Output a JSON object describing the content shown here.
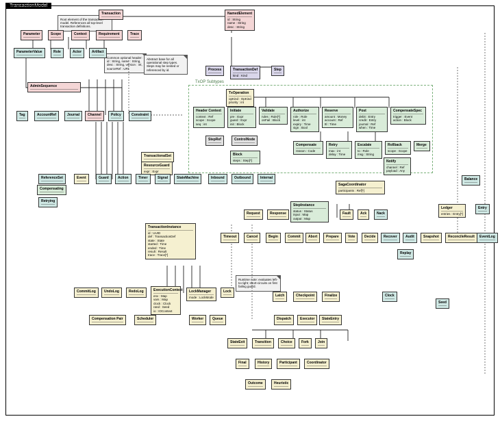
{
  "title": "TransactionModel",
  "package": {
    "label": "TxOP Subtypes"
  },
  "notes": [
    {
      "id": "n1",
      "text": "Root element of the transaction model. References all top-level transaction definitions."
    },
    {
      "id": "n2",
      "text": "Common optional header: id : String, name : String, desc : String, version : int, sourceRef : URI"
    },
    {
      "id": "n3",
      "text": "Abstract base for all operational step types. Steps may be nested or referenced by id."
    },
    {
      "id": "n4",
      "text": "Runtime note: evaluates left-to-right; short-circuits on first failing guard."
    }
  ],
  "nodes": {
    "root": {
      "name": "Transaction"
    },
    "base": {
      "name": "NamedElement",
      "attrs": [
        "id : String",
        "name : String",
        "desc : String"
      ]
    },
    "p_a": {
      "name": "Parameter"
    },
    "p_b": {
      "name": "Scope"
    },
    "p_c": {
      "name": "Context"
    },
    "p_d": {
      "name": "Requirement"
    },
    "p_e": {
      "name": "Trace"
    },
    "t_a": {
      "name": "ParameterValue"
    },
    "t_b": {
      "name": "Role"
    },
    "t_c": {
      "name": "Actor"
    },
    "t_d": {
      "name": "Artifact"
    },
    "t_e": {
      "name": "Tag"
    },
    "t_f": {
      "name": "AccountRef"
    },
    "t_g": {
      "name": "Journal"
    },
    "t_h": {
      "name": "Channel"
    },
    "t_i": {
      "name": "Policy"
    },
    "t_j": {
      "name": "Constraint"
    },
    "row_a": {
      "name": "AdminSequence"
    },
    "row_b": {
      "name": "ReferenceSet"
    },
    "li_a": {
      "name": "Process"
    },
    "li_b": {
      "name": "TransactionDef",
      "attrs": [
        "kind : Kind"
      ]
    },
    "li_c": {
      "name": "Step"
    },
    "mid_a": {
      "name": "StepRef"
    },
    "mid_b": {
      "name": "ControlNode"
    },
    "op_root": {
      "name": "TxOperation",
      "attrs": [
        "opKind : OpKind",
        "priority : int"
      ]
    },
    "op0": {
      "name": "Header Context",
      "attrs": [
        "context : Ref",
        "scope : Scope",
        "seq : int"
      ]
    },
    "op1": {
      "name": "Initiate",
      "attrs": [
        "pre : Expr",
        "guard : Expr",
        "init : Block"
      ]
    },
    "op2": {
      "name": "Validate",
      "attrs": [
        "rules : Rule[*]",
        "onFail : Block"
      ]
    },
    "op3": {
      "name": "Authorize",
      "attrs": [
        "role : Role",
        "level : int",
        "expiry : Time",
        "sign : Bool"
      ]
    },
    "op4": {
      "name": "Reserve",
      "attrs": [
        "amount : Money",
        "account : Ref",
        "ttl : Time"
      ]
    },
    "op5": {
      "name": "Post",
      "attrs": [
        "debit : Entry",
        "credit : Entry",
        "journal : Ref",
        "when : Time"
      ]
    },
    "op6": {
      "name": "CompensateSpec",
      "attrs": [
        "trigger : Event",
        "action : Block"
      ]
    },
    "opChild": {
      "name": "Block",
      "attrs": [
        "steps : Step[*]"
      ]
    },
    "op_a": {
      "name": "Compensate",
      "attrs": [
        "reason : Code"
      ]
    },
    "op_b": {
      "name": "Retry",
      "attrs": [
        "max : int",
        "delay : Time"
      ]
    },
    "op_c": {
      "name": "Escalate",
      "attrs": [
        "to : Role",
        "msg : String"
      ]
    },
    "op_d": {
      "name": "Rollback",
      "attrs": [
        "scope : Scope"
      ]
    },
    "op_e": {
      "name": "Notify",
      "attrs": [
        "channel : Ref",
        "payload : Any"
      ]
    },
    "op_g": {
      "name": "Merge"
    },
    "left_a": {
      "name": "TransactionalSet"
    },
    "left_b": {
      "name": "ResourceGuard",
      "attrs": [
        "expr : Expr"
      ]
    },
    "left_c": {
      "name": "StateMachine"
    },
    "big": {
      "name": "TransactionInstance",
      "attrs": [
        "id : UUID",
        "def : TransactionDef",
        "state : State",
        "started : Time",
        "ended : Time",
        "result : Result",
        "trace : Trace[*]"
      ]
    },
    "inst_a": {
      "name": "Event"
    },
    "inst_b": {
      "name": "Guard"
    },
    "inst_c": {
      "name": "Action"
    },
    "inst_d": {
      "name": "Timer"
    },
    "inst_e": {
      "name": "Signal"
    },
    "hub": {
      "name": "StepInstance",
      "attrs": [
        "status : Status",
        "input : Map",
        "output : Map"
      ]
    },
    "mhdr": {
      "name": "SagaCoordinator",
      "attrs": [
        "participants : Ref[*]"
      ]
    },
    "r1": {
      "name": "Request"
    },
    "r2": {
      "name": "Response"
    },
    "r3": {
      "name": "Fault"
    },
    "r4": {
      "name": "Ack"
    },
    "r5": {
      "name": "Nack"
    },
    "r6": {
      "name": "Timeout"
    },
    "r7": {
      "name": "Cancel"
    },
    "s1": {
      "name": "Inbound"
    },
    "s2": {
      "name": "Outbound"
    },
    "s3": {
      "name": "Internal"
    },
    "s4": {
      "name": "Compensating"
    },
    "s5": {
      "name": "Retrying"
    },
    "rt1": {
      "name": "Ledger",
      "attrs": [
        "entries : Entry[*]"
      ]
    },
    "rt2": {
      "name": "Balance"
    },
    "rt3": {
      "name": "Entry"
    },
    "rt4": {
      "name": "Audit"
    },
    "rt5": {
      "name": "Snapshot"
    },
    "rt6": {
      "name": "ReconcileResult"
    },
    "cr_b": {
      "name": "EventLog"
    },
    "cr_c": {
      "name": "Replay"
    },
    "detail": {
      "name": "ExecutionContext",
      "attrs": [
        "env : Map",
        "vars : Map",
        "clock : Clock",
        "rand : Seed",
        "io : IOContext"
      ]
    },
    "det_a": {
      "name": "Clock"
    },
    "det_b": {
      "name": "Seed"
    },
    "b1": {
      "name": "Begin"
    },
    "b2": {
      "name": "Commit"
    },
    "b3": {
      "name": "Abort"
    },
    "b4": {
      "name": "Prepare"
    },
    "b5": {
      "name": "Vote"
    },
    "b6": {
      "name": "Decide"
    },
    "b7": {
      "name": "Recover"
    },
    "b8": {
      "name": "Checkpoint"
    },
    "b9": {
      "name": "Finalize"
    },
    "c1": {
      "name": "CommitLog"
    },
    "c2": {
      "name": "UndoLog"
    },
    "c3": {
      "name": "RedoLog"
    },
    "c4": {
      "name": "LockManager",
      "attrs": [
        "mode : LockMode"
      ]
    },
    "c5": {
      "name": "Lock"
    },
    "c6": {
      "name": "Latch"
    },
    "l2a": {
      "name": "Compensation Pair"
    },
    "d1": {
      "name": "Scheduler"
    },
    "d2": {
      "name": "Worker"
    },
    "d3": {
      "name": "Queue"
    },
    "d4": {
      "name": "Dispatch"
    },
    "d5": {
      "name": "Executor"
    },
    "e1": {
      "name": "StateEntry"
    },
    "e2": {
      "name": "StateExit"
    },
    "e3": {
      "name": "Transition"
    },
    "e4": {
      "name": "Choice"
    },
    "e5": {
      "name": "Fork"
    },
    "e6": {
      "name": "Join"
    },
    "e7": {
      "name": "Final"
    },
    "e8": {
      "name": "History"
    },
    "f1": {
      "name": "Participant"
    },
    "f2": {
      "name": "Coordinator"
    },
    "f3": {
      "name": "Outcome"
    },
    "f4": {
      "name": "Heuristic"
    }
  }
}
